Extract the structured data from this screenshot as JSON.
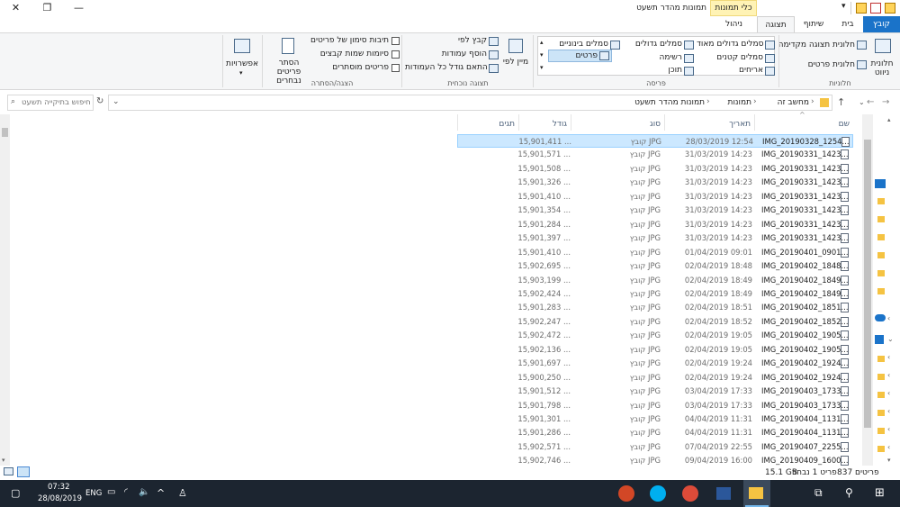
{
  "window": {
    "title": "תמונות מהדר תשעט",
    "context_tab": "כלי תמונות",
    "controls": {
      "close": "✕",
      "maximize": "❐",
      "minimize": "—"
    }
  },
  "ribbon_tabs": [
    {
      "label": "קובץ"
    },
    {
      "label": "בית"
    },
    {
      "label": "שיתוף"
    },
    {
      "label": "תצוגה"
    },
    {
      "label": "ניהול"
    }
  ],
  "ribbon": {
    "panes": {
      "nav_pane": "חלונית ניווט",
      "preview_pane": "חלונית תצוגה מקדימה",
      "details_pane": "חלונית פרטים",
      "group_label": "חלוניות"
    },
    "layout": {
      "items": [
        "סמלים גדולים מאוד",
        "סמלים גדולים",
        "סמלים בינוניים",
        "סמלים קטנים",
        "רשימה",
        "פרטים",
        "אריחים",
        "תוכן"
      ],
      "group_label": "פריסה"
    },
    "current_view": {
      "sort": "מיין לפי",
      "group_by": "קבץ לפי",
      "add_columns": "הוסף עמודות",
      "fit_columns": "התאם גודל כל העמודות",
      "group_label": "תצוגה נוכחית"
    },
    "show_hide": {
      "item_checkboxes": "תיבות סימון של פריטים",
      "file_extensions": "סיומות שמות קבצים",
      "hidden_items": "פריטים מוסתרים",
      "hide_selected": "הסתר פריטים נבחרים",
      "group_label": "הצגה/הסתרה"
    },
    "options": "אפשרויות"
  },
  "address": {
    "breadcrumb": [
      "מחשב זה",
      "תמונות",
      "תמונות מהדר תשעט"
    ],
    "search_placeholder": "חיפוש בתיקייה תשעט"
  },
  "columns": {
    "name": "שם",
    "date": "תאריך",
    "type": "סוג",
    "size": "גודל",
    "tags": "תגים"
  },
  "files": [
    {
      "name": "IMG_20190328_1254...",
      "date": "28/03/2019 12:54",
      "type": "קובץ JPG",
      "size": "15,901,411 ..."
    },
    {
      "name": "IMG_20190331_1423...",
      "date": "31/03/2019 14:23",
      "type": "קובץ JPG",
      "size": "15,901,571 ..."
    },
    {
      "name": "IMG_20190331_1423...",
      "date": "31/03/2019 14:23",
      "type": "קובץ JPG",
      "size": "15,901,508 ..."
    },
    {
      "name": "IMG_20190331_1423...",
      "date": "31/03/2019 14:23",
      "type": "קובץ JPG",
      "size": "15,901,326 ..."
    },
    {
      "name": "IMG_20190331_1423...",
      "date": "31/03/2019 14:23",
      "type": "קובץ JPG",
      "size": "15,901,410 ..."
    },
    {
      "name": "IMG_20190331_1423...",
      "date": "31/03/2019 14:23",
      "type": "קובץ JPG",
      "size": "15,901,354 ..."
    },
    {
      "name": "IMG_20190331_1423...",
      "date": "31/03/2019 14:23",
      "type": "קובץ JPG",
      "size": "15,901,284 ..."
    },
    {
      "name": "IMG_20190331_1423...",
      "date": "31/03/2019 14:23",
      "type": "קובץ JPG",
      "size": "15,901,397 ..."
    },
    {
      "name": "IMG_20190401_0901...",
      "date": "01/04/2019 09:01",
      "type": "קובץ JPG",
      "size": "15,901,410 ..."
    },
    {
      "name": "IMG_20190402_1848...",
      "date": "02/04/2019 18:48",
      "type": "קובץ JPG",
      "size": "15,902,695 ..."
    },
    {
      "name": "IMG_20190402_1849...",
      "date": "02/04/2019 18:49",
      "type": "קובץ JPG",
      "size": "15,903,199 ..."
    },
    {
      "name": "IMG_20190402_1849...",
      "date": "02/04/2019 18:49",
      "type": "קובץ JPG",
      "size": "15,902,424 ..."
    },
    {
      "name": "IMG_20190402_1851...",
      "date": "02/04/2019 18:51",
      "type": "קובץ JPG",
      "size": "15,901,283 ..."
    },
    {
      "name": "IMG_20190402_1852...",
      "date": "02/04/2019 18:52",
      "type": "קובץ JPG",
      "size": "15,902,247 ..."
    },
    {
      "name": "IMG_20190402_1905...",
      "date": "02/04/2019 19:05",
      "type": "קובץ JPG",
      "size": "15,902,472 ..."
    },
    {
      "name": "IMG_20190402_1905...",
      "date": "02/04/2019 19:05",
      "type": "קובץ JPG",
      "size": "15,902,136 ..."
    },
    {
      "name": "IMG_20190402_1924...",
      "date": "02/04/2019 19:24",
      "type": "קובץ JPG",
      "size": "15,901,697 ..."
    },
    {
      "name": "IMG_20190402_1924...",
      "date": "02/04/2019 19:24",
      "type": "קובץ JPG",
      "size": "15,900,250 ..."
    },
    {
      "name": "IMG_20190403_1733...",
      "date": "03/04/2019 17:33",
      "type": "קובץ JPG",
      "size": "15,901,512 ..."
    },
    {
      "name": "IMG_20190403_1733...",
      "date": "03/04/2019 17:33",
      "type": "קובץ JPG",
      "size": "15,901,798 ..."
    },
    {
      "name": "IMG_20190404_1131...",
      "date": "04/04/2019 11:31",
      "type": "קובץ JPG",
      "size": "15,901,301 ..."
    },
    {
      "name": "IMG_20190404_1131...",
      "date": "04/04/2019 11:31",
      "type": "קובץ JPG",
      "size": "15,901,286 ..."
    },
    {
      "name": "IMG_20190407_2255...",
      "date": "07/04/2019 22:55",
      "type": "קובץ JPG",
      "size": "15,902,571 ..."
    },
    {
      "name": "IMG_20190409_1600...",
      "date": "09/04/2019 16:00",
      "type": "קובץ JPG",
      "size": "15,902,746 ..."
    }
  ],
  "status": {
    "count": "837 פריטים",
    "selected": "פריט 1 נבחר",
    "selected_size": "15.1 GB"
  },
  "taskbar": {
    "time": "07:32",
    "date": "28/08/2019",
    "lang": "ENG"
  },
  "colors": {
    "accent": "#1a73c9",
    "selection": "#cce8ff",
    "taskbar": "#1c2530",
    "context_tab": "#fff3b5"
  }
}
